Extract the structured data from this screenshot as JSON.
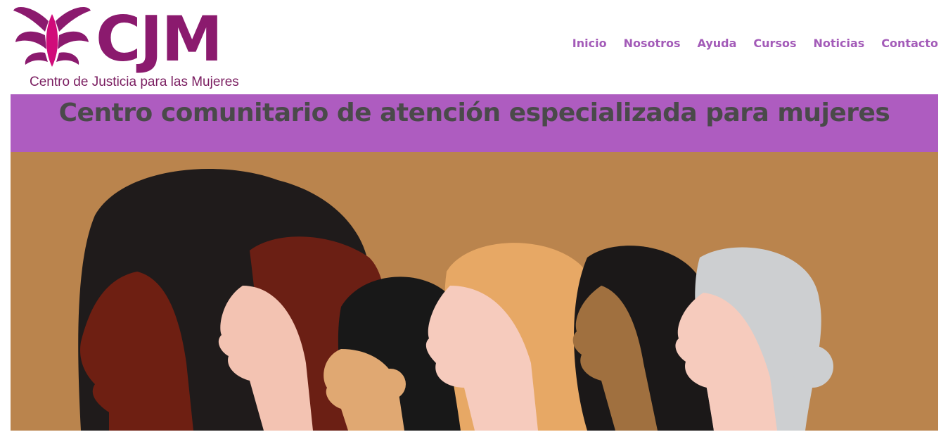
{
  "logo": {
    "text": "CJM",
    "tagline": "Centro de Justicia para las Mujeres",
    "mark_icon": "butterfly-icon"
  },
  "nav": {
    "items": [
      "Inicio",
      "Nosotros",
      "Ayuda",
      "Cursos",
      "Noticias",
      "Contacto"
    ]
  },
  "banner": {
    "title": "Centro comunitario de atención especializada para mujeres"
  },
  "colors": {
    "brand": "#8b1a6e",
    "nav": "#a35bb8",
    "banner_bg": "#ae5cc0",
    "hero_bg": "#ba844d"
  }
}
